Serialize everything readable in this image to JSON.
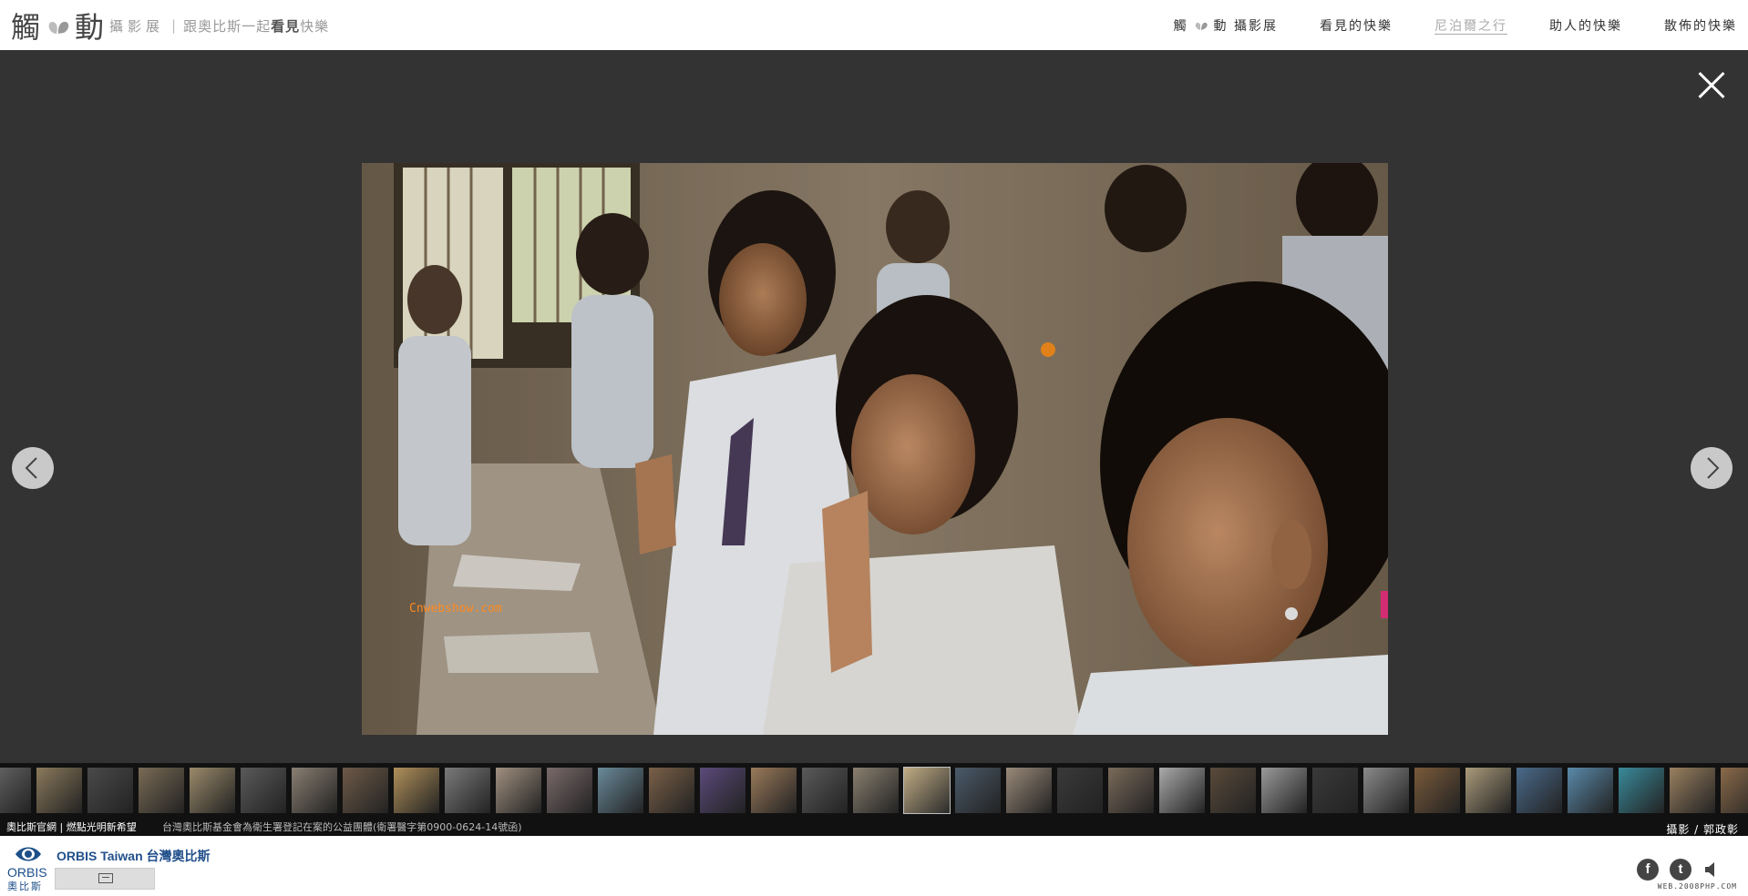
{
  "header": {
    "brand_char_1": "觸",
    "brand_char_2": "動",
    "brand_sub": "攝影展",
    "brand_sep": "|",
    "brand_tag_pre": "跟奧比斯一起",
    "brand_tag_bold": "看見",
    "brand_tag_post": "快樂",
    "nav": [
      {
        "label_a": "觸",
        "label_b": "動 攝影展",
        "active": false
      },
      {
        "label": "看見的快樂",
        "active": false
      },
      {
        "label": "尼泊爾之行",
        "active": true
      },
      {
        "label": "助人的快樂",
        "active": false
      },
      {
        "label": "散佈的快樂",
        "active": false
      }
    ]
  },
  "viewer": {
    "close_icon": "close-icon",
    "prev_icon": "chevron-left-icon",
    "next_icon": "chevron-right-icon",
    "watermark": "Cnwebshow.com",
    "current_thumb_index": 18
  },
  "filmstrip_colors": [
    "#6b6b6b",
    "#8b7a5c",
    "#4a4a4a",
    "#7a6b55",
    "#9a8a6a",
    "#5a5a5a",
    "#8a7f72",
    "#6e5a48",
    "#b0905a",
    "#7a7a7a",
    "#a09080",
    "#7a6a6a",
    "#6a8a9a",
    "#7a6048",
    "#5a4a7a",
    "#9a7a5a",
    "#5a5a5a",
    "#8a8070",
    "#9a8a6a",
    "#4a5a6a",
    "#9a8a7a",
    "#3a3a3a",
    "#7a6a5a",
    "#aaaaaa",
    "#5a4a3a",
    "#9a9a9a",
    "#3a3a3a",
    "#8a8a8a",
    "#7a5a3a",
    "#aa9a7a",
    "#4a6a8a",
    "#5a8aaa",
    "#3a8a9a",
    "#9a8060",
    "#8a6a4a",
    "#6a6a6a"
  ],
  "caption": {
    "official_link": "奧比斯官網 | 燃點光明新希望",
    "notice": "台灣奧比斯基金會為衛生署登記在案的公益團體(衛署醫字第0900-0624-14號函)",
    "credit": "攝影 / 郭政彰"
  },
  "footer": {
    "logo_en": "ORBIS",
    "logo_zh": "奧比斯",
    "page_name": "ORBIS Taiwan 台灣奧比斯",
    "social": [
      {
        "icon": "facebook-icon",
        "glyph": "f"
      },
      {
        "icon": "twitter-icon",
        "glyph": "t"
      }
    ],
    "sound_icon": "speaker-icon",
    "site_mark": "WEB.2008PHP.COM"
  }
}
